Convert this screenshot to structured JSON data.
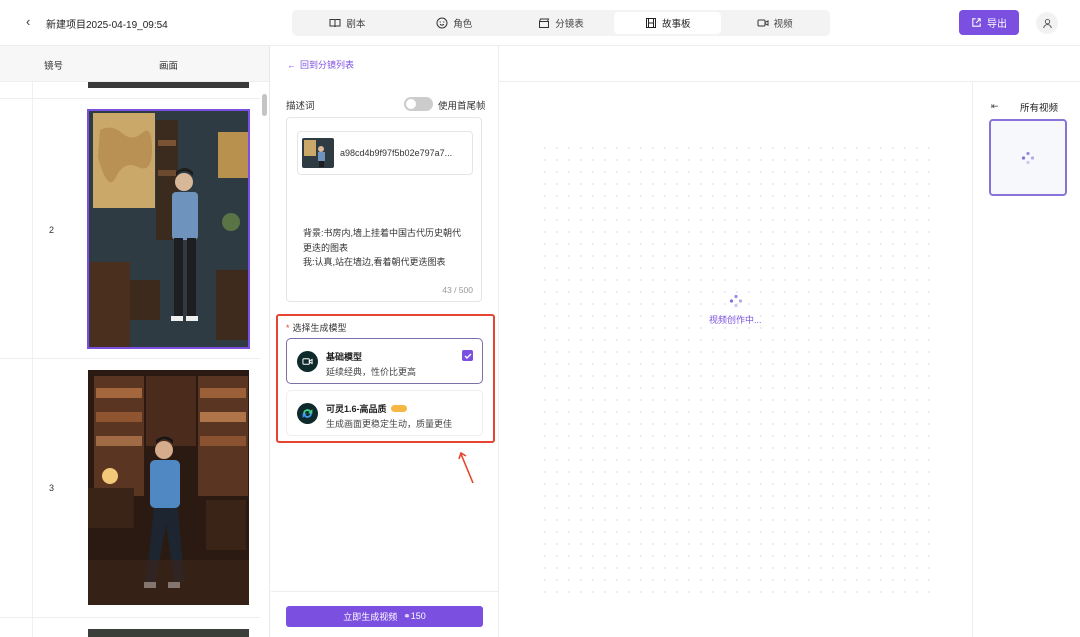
{
  "header": {
    "project_title": "新建项目2025-04-19_09:54",
    "tabs": [
      {
        "label": "剧本",
        "icon": "book-icon",
        "active": false
      },
      {
        "label": "角色",
        "icon": "smile-icon",
        "active": false
      },
      {
        "label": "分镜表",
        "icon": "clapper-icon",
        "active": false
      },
      {
        "label": "故事板",
        "icon": "film-icon",
        "active": true
      },
      {
        "label": "视频",
        "icon": "video-camera-icon",
        "active": false
      }
    ],
    "export_label": "导出"
  },
  "shot_list": {
    "col_number": "镜号",
    "col_image": "画面",
    "rows": [
      {
        "number": "2",
        "selected": true
      },
      {
        "number": "3",
        "selected": false
      }
    ]
  },
  "control": {
    "back_link": "回到分镜列表",
    "desc_label": "描述词",
    "toggle_label": "使用首尾帧",
    "toggle_on": false,
    "ref_image_name": "a98cd4b9f97f5b02e797a7...",
    "prompt_line1": "背景:书房内,墙上挂着中国古代历史朝代",
    "prompt_line2": "更迭的图表",
    "prompt_line3": "我:认真,站在墙边,看着朝代更迭图表",
    "char_count": "43 / 500",
    "model_label": "选择生成模型",
    "models": [
      {
        "title": "基础模型",
        "subtitle": "延续经典，性价比更高",
        "selected": true
      },
      {
        "title": "可灵1.6-高品质",
        "subtitle": "生成画面更稳定生动，质量更佳",
        "selected": false
      }
    ],
    "generate_label": "立即生成视频",
    "generate_cost": "150"
  },
  "preview": {
    "status_text": "视频创作中..."
  },
  "right_panel": {
    "title": "所有视频"
  },
  "colors": {
    "accent": "#7b4fe0",
    "highlight": "#e5452f"
  }
}
